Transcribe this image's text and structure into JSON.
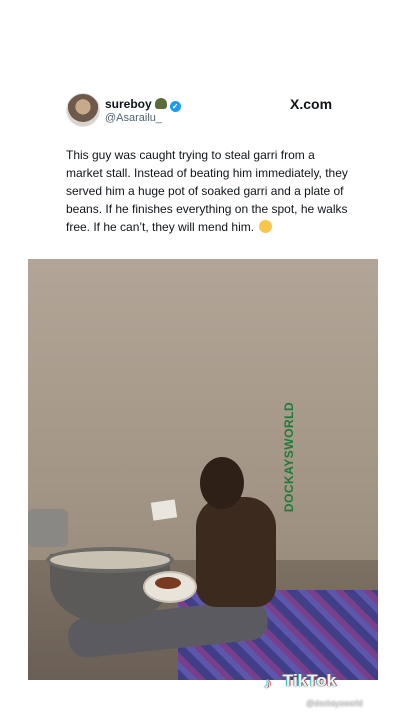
{
  "post": {
    "display_name": "sureboy",
    "handle": "@Asarailu_",
    "site": "X.com",
    "text": "This guy was caught trying to steal garri from a market stall. Instead of beating him immediately, they served him a huge pot of soaked garri and a plate of beans. If he finishes everything on the spot, he walks free. If he can’t, they will mend him."
  },
  "video": {
    "watermark_vertical": "DOCKAYSWORLD",
    "tiktok_label": "TikTok",
    "tiktok_handle": "@dockaysworld"
  },
  "icons": {
    "badge": "military-helmet-emoji",
    "verified": "verified-check-icon",
    "emoji": "crying-laughing-emoji",
    "tiktok": "tiktok-note-icon"
  },
  "colors": {
    "verified": "#1d9bf0",
    "watermark": "#1f7a3a"
  }
}
